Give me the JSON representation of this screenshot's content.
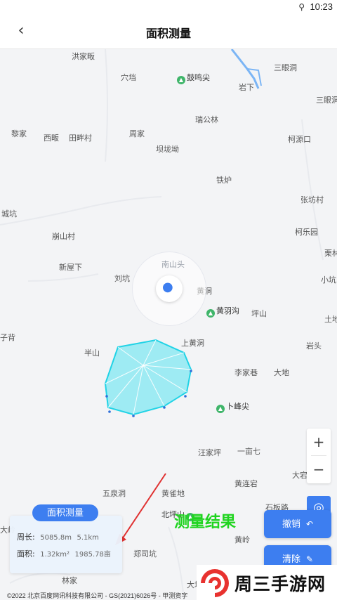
{
  "status_bar": {
    "location_icon": "location-icon",
    "time": "10:23"
  },
  "header": {
    "title": "面积测量",
    "back_icon": "chevron-left-icon"
  },
  "map": {
    "places": [
      {
        "name": "洪家畈"
      },
      {
        "name": "穴垱"
      },
      {
        "name": "三眼洞"
      },
      {
        "name": "岩下"
      },
      {
        "name": "三眼洞"
      },
      {
        "name": "瑞公林"
      },
      {
        "name": "黎家"
      },
      {
        "name": "西畈"
      },
      {
        "name": "田畔村"
      },
      {
        "name": "周家"
      },
      {
        "name": "坝垅坳"
      },
      {
        "name": "柯源口"
      },
      {
        "name": "铁炉"
      },
      {
        "name": "张坊村"
      },
      {
        "name": "城坑"
      },
      {
        "name": "崩山村"
      },
      {
        "name": "柯乐园"
      },
      {
        "name": "栗林"
      },
      {
        "name": "新屋下"
      },
      {
        "name": "刘坑"
      },
      {
        "name": "黄洞"
      },
      {
        "name": "小坑"
      },
      {
        "name": "坪山"
      },
      {
        "name": "土地"
      },
      {
        "name": "子背"
      },
      {
        "name": "上黄洞"
      },
      {
        "name": "岩头"
      },
      {
        "name": "半山"
      },
      {
        "name": "李家巷"
      },
      {
        "name": "大地"
      },
      {
        "name": "汪家坪"
      },
      {
        "name": "一亩七"
      },
      {
        "name": "大宕"
      },
      {
        "name": "黄连宕"
      },
      {
        "name": "五泉洞"
      },
      {
        "name": "黄雀地"
      },
      {
        "name": "石板路"
      },
      {
        "name": "郑司坑"
      },
      {
        "name": "黄岭"
      },
      {
        "name": "林家"
      },
      {
        "name": "大坑"
      },
      {
        "name": "大岭"
      }
    ],
    "pois": [
      {
        "name": "鼓鸣尖"
      },
      {
        "name": "黄羽沟"
      },
      {
        "name": "卜峰尖"
      },
      {
        "name": "北坪山"
      }
    ],
    "current_location_label": "南山头"
  },
  "controls": {
    "zoom_in": "+",
    "zoom_out": "−",
    "locate_icon": "locate-icon"
  },
  "annotation": {
    "text": "测量结果"
  },
  "result": {
    "tab_label": "面积测量",
    "perimeter_label": "周长:",
    "perimeter_m": "5085.8m",
    "perimeter_km": "5.1km",
    "area_label": "面积:",
    "area_km2": "1.32km²",
    "area_mu": "1985.78亩"
  },
  "actions": {
    "undo_label": "撤销",
    "clear_label": "清除"
  },
  "copyright": "©2022 北京百度网讯科技有限公司 - GS(2021)6026号 - 甲测资字",
  "watermark": {
    "text": "周三手游网"
  },
  "colors": {
    "accent": "#3d7ef0",
    "polygon_fill": "#8ee9f2",
    "polygon_stroke": "#21d3e6",
    "annotation": "#1fd41f",
    "arrow": "#e03131"
  }
}
